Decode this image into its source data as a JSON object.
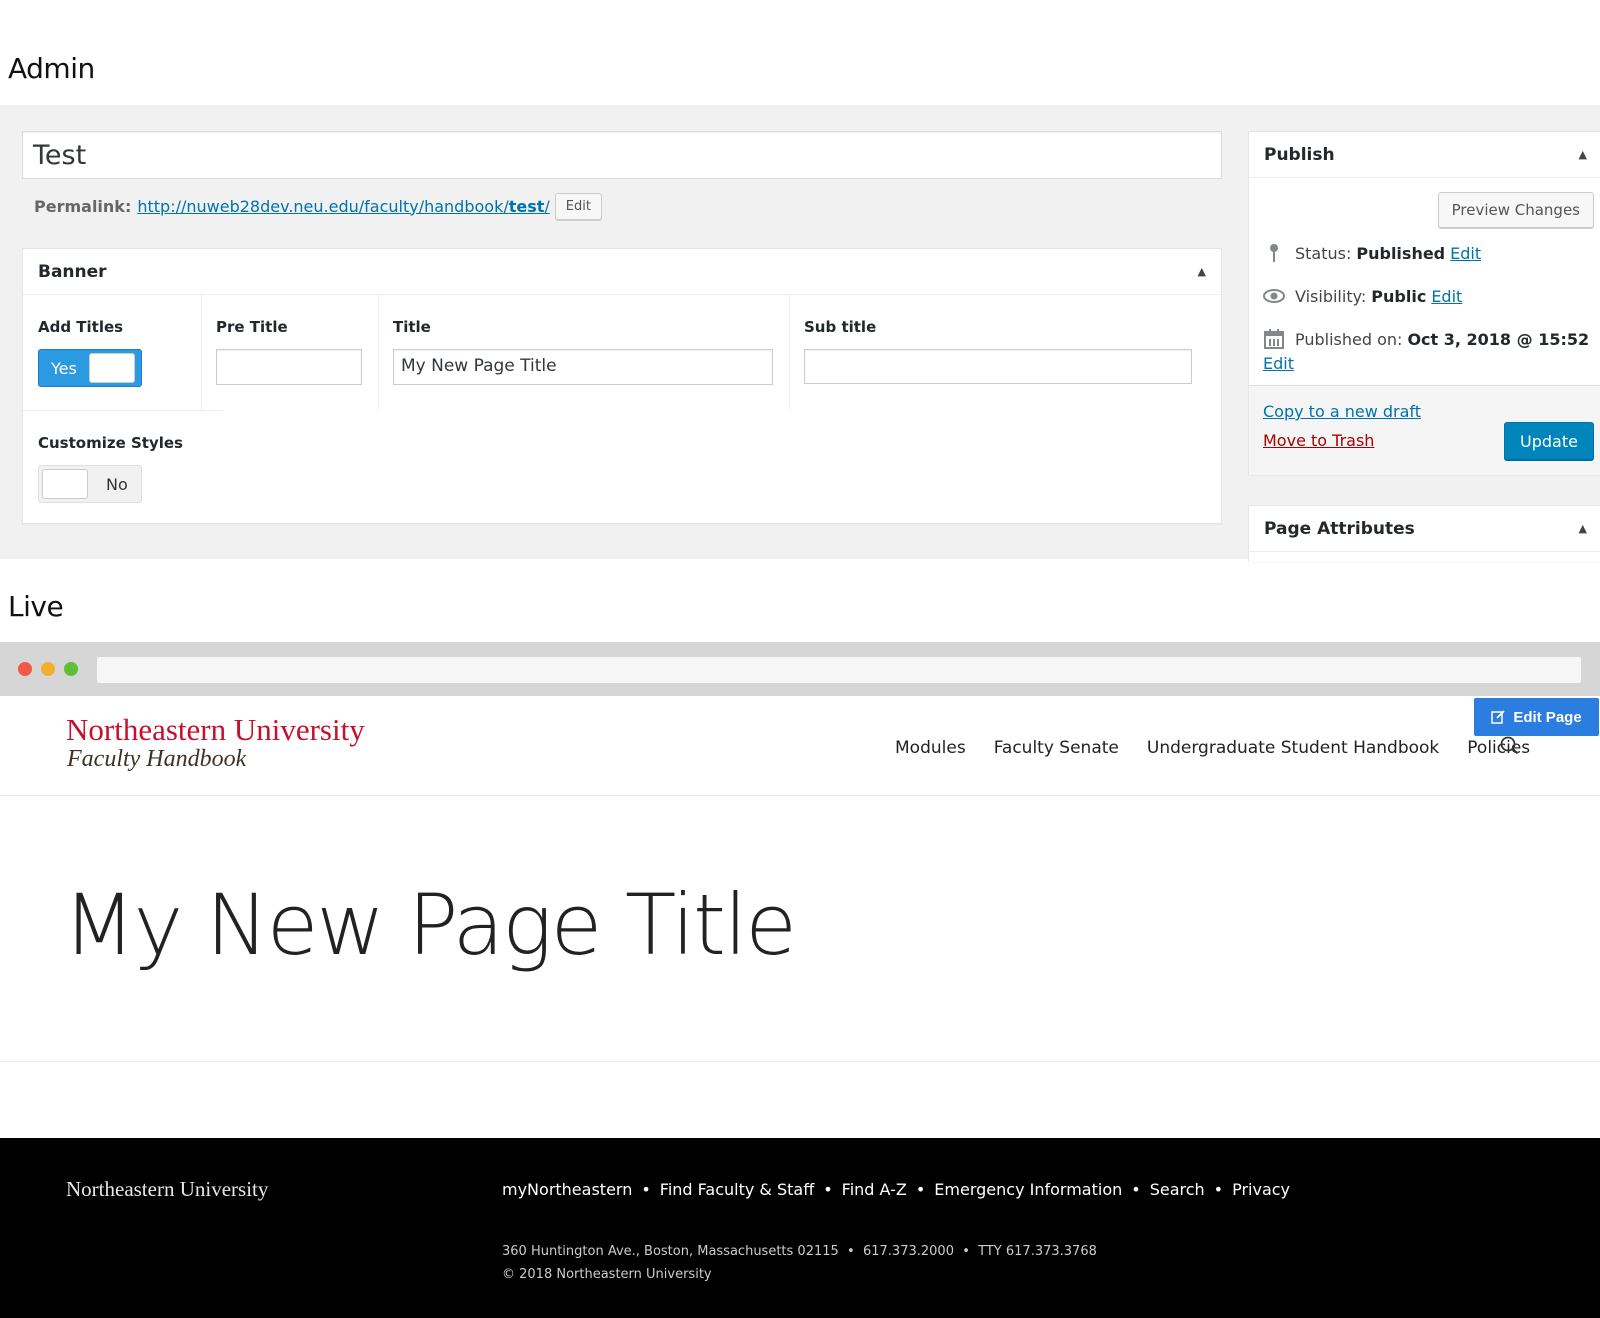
{
  "sections": {
    "admin_heading": "Admin",
    "live_heading": "Live"
  },
  "admin": {
    "post_title": "Test",
    "permalink": {
      "label": "Permalink:",
      "url_prefix": "http://nuweb28dev.neu.edu/faculty/handbook/",
      "slug": "test",
      "url_suffix": "/",
      "edit_label": "Edit"
    },
    "banner": {
      "heading": "Banner",
      "add_titles": {
        "label": "Add Titles",
        "toggle_label": "Yes",
        "value": true
      },
      "pre_title": {
        "label": "Pre Title",
        "value": ""
      },
      "title": {
        "label": "Title",
        "value": "My New Page Title"
      },
      "sub_title": {
        "label": "Sub title",
        "value": ""
      },
      "customize_styles": {
        "label": "Customize Styles",
        "toggle_label": "No",
        "value": false
      }
    },
    "publish": {
      "heading": "Publish",
      "preview_label": "Preview Changes",
      "status_label": "Status:",
      "status_value": "Published",
      "visibility_label": "Visibility:",
      "visibility_value": "Public",
      "published_label": "Published on:",
      "published_value": "Oct 3, 2018 @ 15:52",
      "edit_label": "Edit",
      "copy_draft_label": "Copy to a new draft",
      "trash_label": "Move to Trash",
      "update_label": "Update"
    },
    "page_attributes": {
      "heading": "Page Attributes"
    }
  },
  "live": {
    "logo_line1": "Northeastern University",
    "logo_line2": "Faculty Handbook",
    "nav": [
      "Modules",
      "Faculty Senate",
      "Undergraduate Student Handbook",
      "Policies"
    ],
    "edit_page_label": "Edit Page",
    "page_title": "My New Page Title",
    "footer": {
      "logo": "Northeastern University",
      "links": [
        "myNortheastern",
        "Find Faculty & Staff",
        "Find A-Z",
        "Emergency Information",
        "Search",
        "Privacy"
      ],
      "address_line": "360 Huntington Ave., Boston, Massachusetts 02115  •  617.373.2000  •  TTY 617.373.3768",
      "copyright": "© 2018 Northeastern University"
    }
  },
  "colors": {
    "wp_blue": "#0073aa",
    "update_button": "#0085ba",
    "toggle_on": "#2b9ae0",
    "trash_red": "#a00",
    "brand_red": "#c8102e",
    "edit_page_button": "#2b7de0",
    "footer_bg": "#000000",
    "traffic_red": "#ee5a44",
    "traffic_yellow": "#f0b02c",
    "traffic_green": "#5cc139"
  }
}
